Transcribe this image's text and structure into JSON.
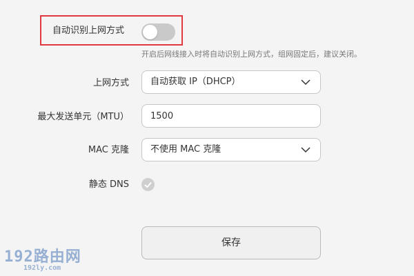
{
  "auto_detect": {
    "label": "自动识别上网方式",
    "toggle_state": "off",
    "hint": "开启后网线接入时将自动识别上网方式，组网固定后，建议关闭。"
  },
  "connection_type": {
    "label": "上网方式",
    "selected": "自动获取 IP（DHCP）"
  },
  "mtu": {
    "label": "最大发送单元（MTU）",
    "value": "1500"
  },
  "mac_clone": {
    "label": "MAC 克隆",
    "selected": "不使用 MAC 克隆"
  },
  "static_dns": {
    "label": "静态 DNS",
    "checked": true
  },
  "save_button": {
    "label": "保存"
  },
  "watermark": {
    "main": "192路由网",
    "sub": "192ly.com"
  },
  "colors": {
    "highlight_border": "#e0383e",
    "toggle_off": "#c9c9c9",
    "background": "#f4f4f4",
    "watermark": "#4a78b8"
  },
  "icons": {
    "dropdown": "chevron-down-icon",
    "static_dns": "check-circle-icon"
  }
}
